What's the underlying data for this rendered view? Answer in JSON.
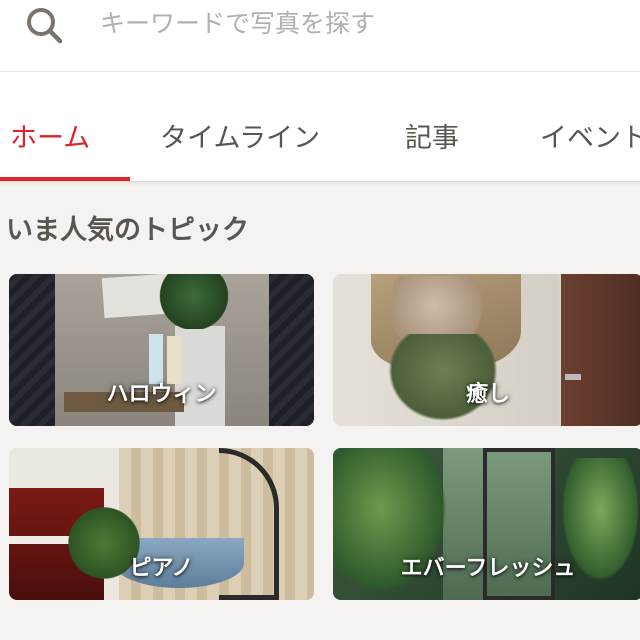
{
  "search": {
    "placeholder": "キーワードで写真を探す",
    "value": ""
  },
  "tabs": [
    {
      "label": "ホーム",
      "active": true
    },
    {
      "label": "タイムライン",
      "active": false
    },
    {
      "label": "記事",
      "active": false
    },
    {
      "label": "イベント",
      "active": false
    }
  ],
  "section": {
    "title": "いま人気のトピック"
  },
  "topics": [
    {
      "label": "ハロウィン"
    },
    {
      "label": "癒し"
    },
    {
      "label": "ピアノ"
    },
    {
      "label": "エバーフレッシュ"
    }
  ],
  "colors": {
    "accent": "#d8262b",
    "text": "#5b5550",
    "background": "#f4f3f1"
  }
}
